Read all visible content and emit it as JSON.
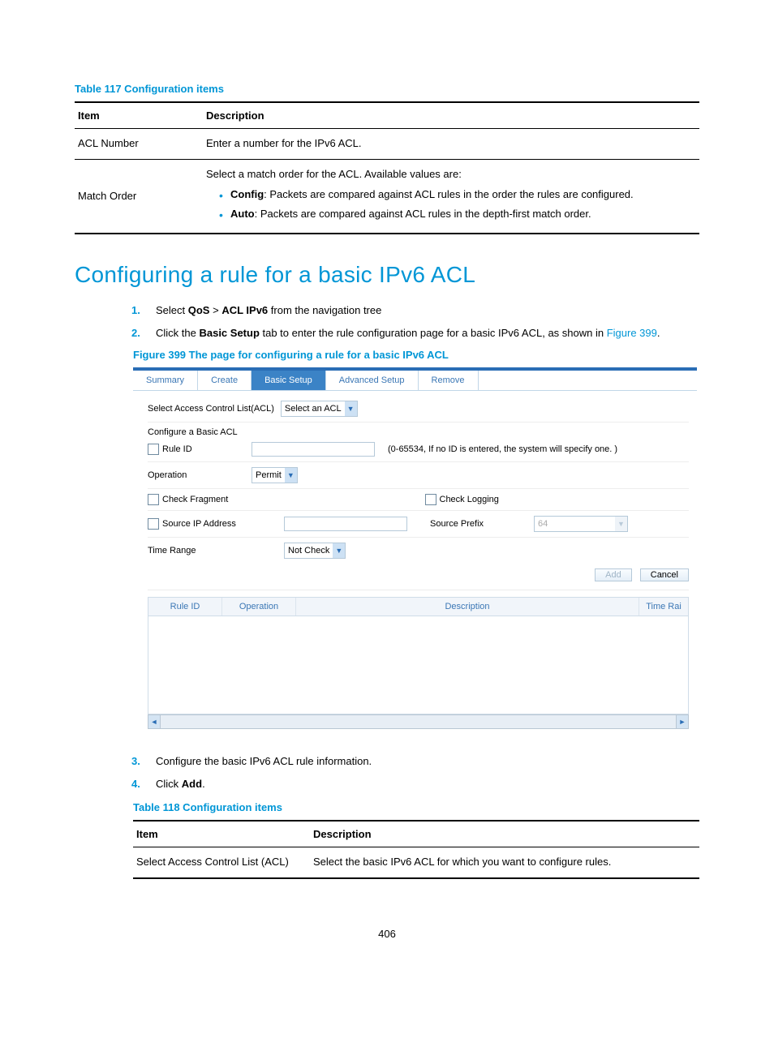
{
  "table117": {
    "caption": "Table 117 Configuration items",
    "headers": [
      "Item",
      "Description"
    ],
    "rows": [
      {
        "item": "ACL Number",
        "desc_lead": "Enter a number for the IPv6 ACL."
      },
      {
        "item": "Match Order",
        "desc_lead": "Select a match order for the ACL. Available values are:",
        "bullets": [
          {
            "bold": "Config",
            "text": ": Packets are compared against ACL rules in the order the rules are configured."
          },
          {
            "bold": "Auto",
            "text": ": Packets are compared against ACL rules in the depth-first match order."
          }
        ]
      }
    ]
  },
  "heading": "Configuring a rule for a basic IPv6 ACL",
  "steps_top": [
    {
      "num": "1.",
      "parts": [
        "Select ",
        "QoS",
        " > ",
        "ACL IPv6",
        " from the navigation tree"
      ]
    },
    {
      "num": "2.",
      "parts": [
        "Click the ",
        "Basic Setup",
        " tab to enter the rule configuration page for a basic IPv6 ACL, as shown in "
      ],
      "link": "Figure 399",
      "tail": "."
    }
  ],
  "figure_caption": "Figure 399 The page for configuring a rule for a basic IPv6 ACL",
  "ui": {
    "tabs": [
      "Summary",
      "Create",
      "Basic Setup",
      "Advanced Setup",
      "Remove"
    ],
    "active_tab": "Basic Setup",
    "select_acl_label": "Select Access Control List(ACL)",
    "select_acl_value": "Select an ACL",
    "section_title": "Configure a Basic ACL",
    "rule_id_label": "Rule ID",
    "rule_id_hint": "(0-65534, If no ID is entered, the system will specify one. )",
    "operation_label": "Operation",
    "operation_value": "Permit",
    "check_fragment": "Check Fragment",
    "check_logging": "Check Logging",
    "source_ip": "Source IP Address",
    "source_prefix": "Source Prefix",
    "source_prefix_value": "64",
    "time_range_label": "Time Range",
    "time_range_value": "Not Check",
    "add_btn": "Add",
    "cancel_btn": "Cancel",
    "grid_headers": [
      "Rule ID",
      "Operation",
      "Description",
      "Time Rai"
    ]
  },
  "steps_bottom": [
    {
      "num": "3.",
      "text": "Configure the basic IPv6 ACL rule information."
    },
    {
      "num": "4.",
      "parts": [
        "Click ",
        "Add",
        "."
      ]
    }
  ],
  "table118": {
    "caption": "Table 118 Configuration items",
    "headers": [
      "Item",
      "Description"
    ],
    "rows": [
      {
        "item": "Select Access Control List (ACL)",
        "desc": "Select the basic IPv6 ACL for which you want to configure rules."
      }
    ]
  },
  "page_number": "406"
}
